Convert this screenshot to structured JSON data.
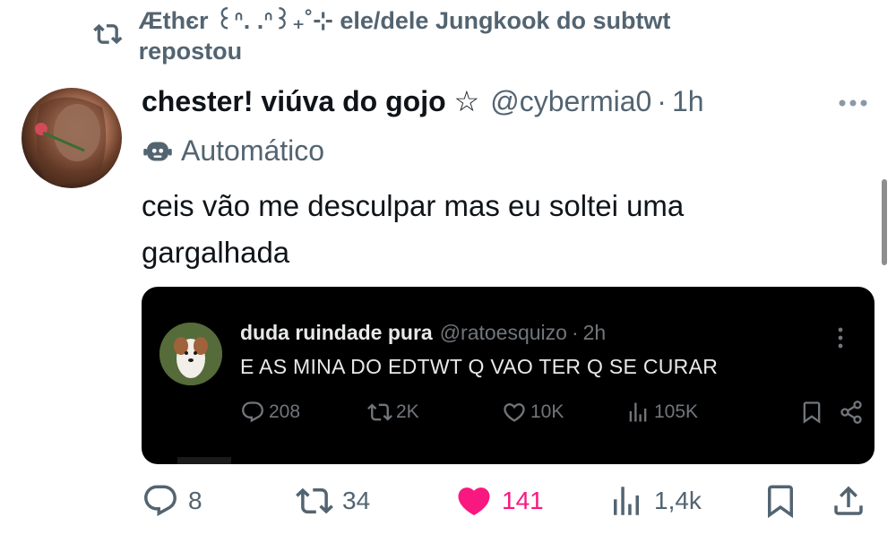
{
  "repost": {
    "text": "Æthєr ꒰ᐢ. .ᐢ꒱₊˚⊹ ele/dele Jungkook do subtwt repostou"
  },
  "tweet": {
    "display_name": "chester! viúva do gojo ☆",
    "handle": "@cybermia0",
    "separator": "·",
    "time": "1h",
    "automated_label": "Automático",
    "text": "ceis vão me desculpar mas eu soltei uma gargalhada",
    "actions": {
      "replies": "8",
      "reposts": "34",
      "likes": "141",
      "views": "1,4k"
    },
    "like_color": "#f91880"
  },
  "quote": {
    "display_name": "duda ruindade pura",
    "handle": "@ratoesquizo",
    "separator": "·",
    "time": "2h",
    "text": "E AS MINA DO EDTWT Q VAO TER Q SE CURAR",
    "actions": {
      "replies": "208",
      "reposts": "2K",
      "likes": "10K",
      "views": "105K"
    }
  },
  "icons": {
    "repost": "repost-icon",
    "more": "more-icon",
    "bot": "bot-icon",
    "reply": "reply-icon",
    "like": "heart-icon",
    "views": "views-icon",
    "bookmark": "bookmark-icon",
    "share": "share-icon"
  }
}
